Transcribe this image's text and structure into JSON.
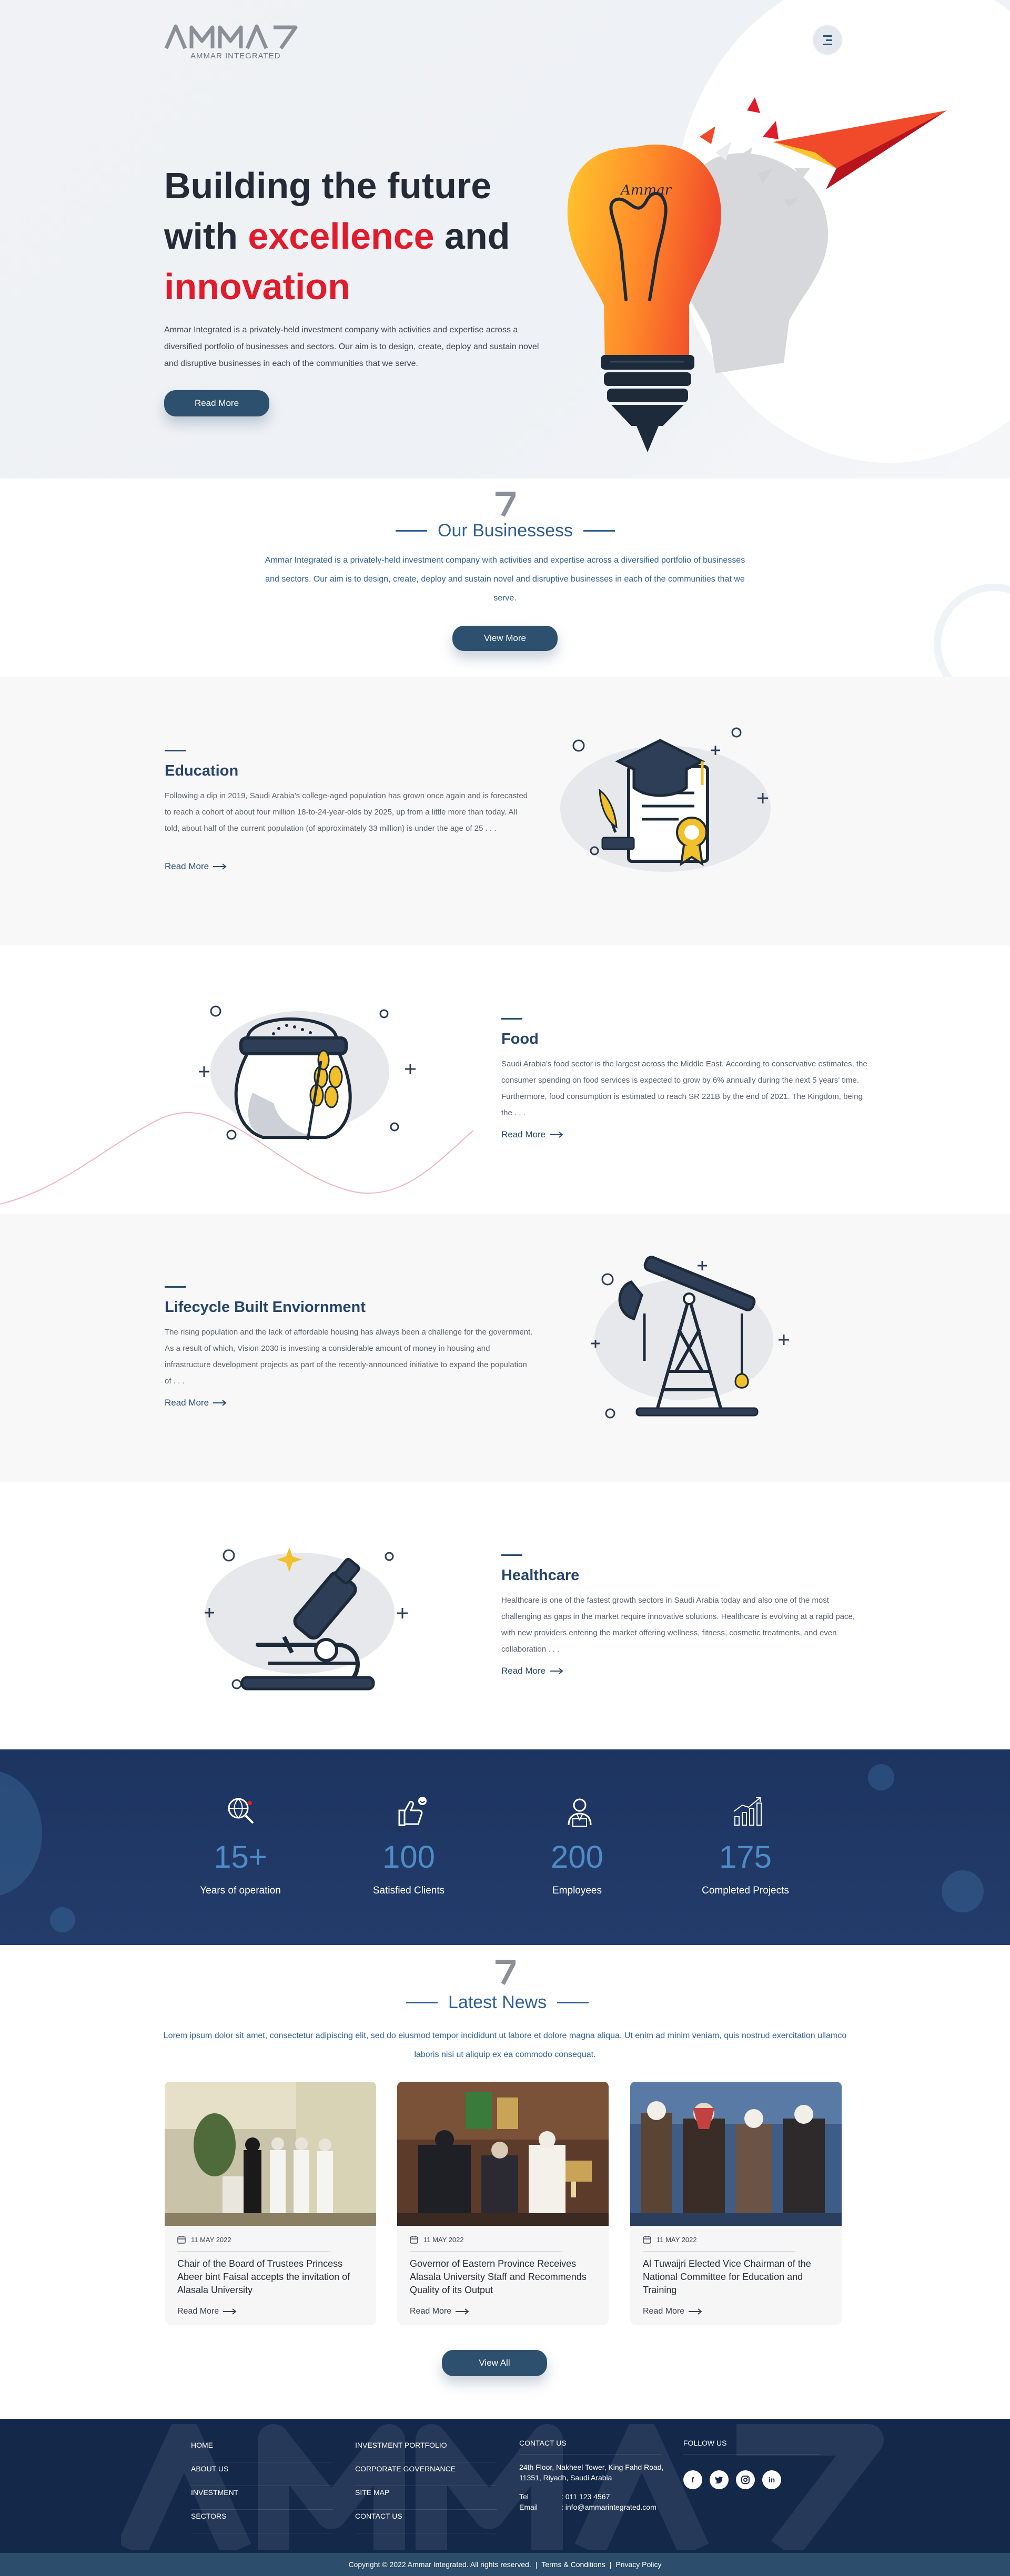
{
  "brand": {
    "logo_text": "AMMAR",
    "tagline": "AMMAR INTEGRATED",
    "bulb_text": "Ammar"
  },
  "hero": {
    "title_line1": "Building the future",
    "title_with": "with ",
    "title_red1": "excellence",
    "title_and": " and",
    "title_red2": "innovation",
    "description": "Ammar Integrated is a privately-held investment company with activities and expertise across a diversified portfolio of businesses and sectors. Our aim is to design, create, deploy and sustain novel and disruptive businesses in each of the communities that we serve.",
    "button": "Read More"
  },
  "businesses": {
    "title": "Our Businessess",
    "description": "Ammar Integrated is a privately-held investment company with activities and expertise across a diversified portfolio of businesses and sectors. Our aim is to design, create, deploy and sustain novel and disruptive businesses in each of the communities that we serve.",
    "button": "View More"
  },
  "sectors": [
    {
      "title": "Education",
      "text": "Following a dip in 2019, Saudi Arabia's college-aged population has grown once again and is forecasted to reach a cohort of about four million 18-to-24-year-olds by 2025, up from a little more than today. All told, about half of the current population (of approximately 33 million) is under the age of 25 . . .",
      "link": "Read More"
    },
    {
      "title": "Food",
      "text": "Saudi Arabia's food sector is the largest across the Middle East. According to conservative estimates, the consumer spending on food services is expected to grow by 6% annually during the next 5 years' time. Furthermore, food consumption is estimated to reach SR 221B by the end of 2021. The Kingdom, being the . . .",
      "link": "Read More"
    },
    {
      "title": "Lifecycle Built Enviornment",
      "text": "The rising population and the lack of affordable housing has always been a challenge for the government. As a result of which, Vision 2030 is investing a considerable amount of money in housing and infrastructure development projects as part of the recently-announced initiative to expand the population of . . .",
      "link": "Read More"
    },
    {
      "title": "Healthcare",
      "text": "Healthcare is one of the fastest growth sectors in Saudi Arabia today and also one of the most challenging as gaps in the market require innovative solutions. Healthcare is evolving at a rapid pace, with new providers entering the market offering wellness, fitness, cosmetic treatments, and even collaboration . . .",
      "link": "Read More"
    }
  ],
  "stats": [
    {
      "value": "15+",
      "label": "Years of operation",
      "icon": "globe-search-icon"
    },
    {
      "value": "100",
      "label": "Satisfied Clients",
      "icon": "thumbs-up-icon"
    },
    {
      "value": "200",
      "label": "Employees",
      "icon": "employee-icon"
    },
    {
      "value": "175",
      "label": "Completed Projects",
      "icon": "growth-chart-icon"
    }
  ],
  "news": {
    "title": "Latest News",
    "description": "Lorem ipsum dolor sit amet, consectetur adipiscing elit, sed do eiusmod tempor incididunt ut labore et dolore magna aliqua. Ut enim ad minim veniam, quis nostrud exercitation ullamco laboris nisi ut aliquip ex ea commodo consequat.",
    "items": [
      {
        "date": "11 MAY 2022",
        "title": "Chair of the Board of Trustees Princess Abeer bint Faisal accepts the invitation of Alasala University",
        "link": "Read More"
      },
      {
        "date": "11 MAY 2022",
        "title": "Governor of Eastern Province Receives Alasala University Staff and Recommends Quality of its Output",
        "link": "Read More"
      },
      {
        "date": "11 MAY 2022",
        "title": "Al Tuwaijri Elected Vice Chairman of the National Committee for Education and Training",
        "link": "Read More"
      }
    ],
    "button": "View All"
  },
  "footer": {
    "col1": [
      "HOME",
      "ABOUT US",
      "INVESTMENT",
      "SECTORS"
    ],
    "col2": [
      "INVESTMENT PORTFOLIO",
      "CORPORATE GOVERNANCE",
      "SITE MAP",
      "CONTACT US"
    ],
    "contact_heading": "CONTACT US",
    "address": "24th Floor, Nakheel Tower, King Fahd Road, 11351, Riyadh, Saudi Arabia",
    "tel_label": "Tel",
    "tel_value": ": 011 123 4567",
    "email_label": "Email",
    "email_value": ": info@ammarintegrated.com",
    "follow_heading": "FOLLOW US",
    "social": [
      "facebook-icon",
      "twitter-icon",
      "instagram-icon",
      "linkedin-icon"
    ],
    "copyright": "Copyright © 2022 Ammar Integrated. All rights reserved.",
    "terms": "Terms & Conditions",
    "privacy": "Privacy Policy",
    "separator": "|"
  },
  "colors": {
    "primary": "#2d506f",
    "accent_red": "#e01b2b",
    "title_blue": "#2f5f94",
    "navy": "#1d3461",
    "stat_blue": "#4d8cc7"
  }
}
